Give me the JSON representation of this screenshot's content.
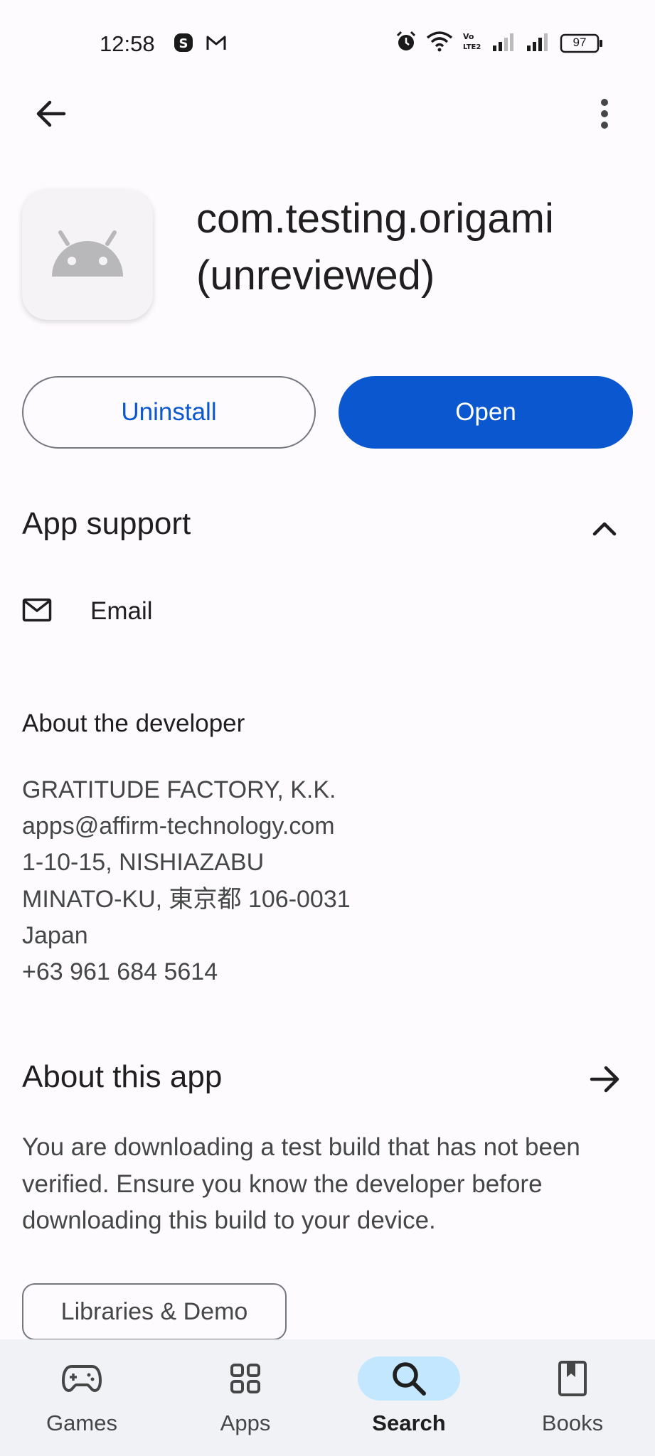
{
  "status_bar": {
    "time": "12:58",
    "battery": "97",
    "icons": [
      "skype-icon",
      "gmail-icon",
      "alarm-icon",
      "wifi-icon",
      "volte-icon",
      "signal-icon",
      "signal-icon",
      "battery-icon"
    ]
  },
  "app": {
    "title": "com.testing.origami (unreviewed)",
    "icon": "android-icon"
  },
  "actions": {
    "uninstall_label": "Uninstall",
    "open_label": "Open"
  },
  "app_support": {
    "title": "App support",
    "email_label": "Email",
    "about_developer_title": "About the developer",
    "developer_lines": [
      "GRATITUDE FACTORY, K.K.",
      "apps@affirm-technology.com",
      "1-10-15, NISHIAZABU",
      "MINATO-KU, 東京都 106-0031",
      "Japan",
      "+63 961 684 5614"
    ]
  },
  "about_app": {
    "title": "About this app",
    "description": "You are downloading a test build that has not been verified. Ensure you know the developer before downloading this build to your device.",
    "chip_label": "Libraries & Demo"
  },
  "bottom_nav": {
    "items": [
      {
        "label": "Games",
        "icon": "gamepad-icon"
      },
      {
        "label": "Apps",
        "icon": "apps-grid-icon"
      },
      {
        "label": "Search",
        "icon": "search-icon",
        "active": true
      },
      {
        "label": "Books",
        "icon": "book-icon"
      }
    ]
  },
  "colors": {
    "accent": "#0b57d0",
    "nav_active_pill": "#c2e7ff",
    "background": "#fefbfe"
  }
}
